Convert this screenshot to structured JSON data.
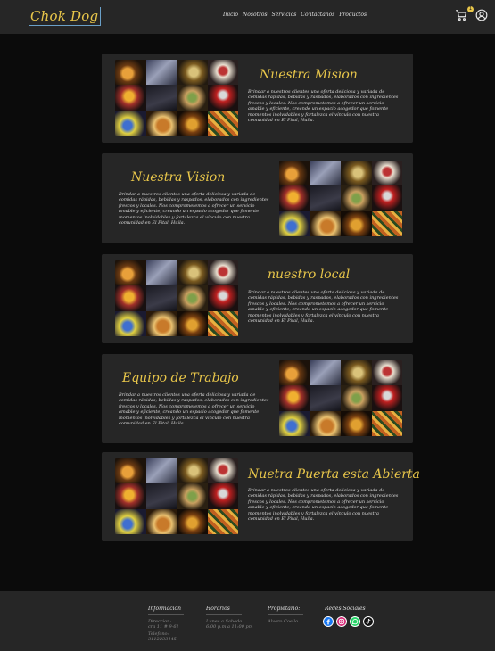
{
  "header": {
    "logo": "Chok Dog",
    "nav": [
      "Inicio",
      "Nosotros",
      "Servicios",
      "Contactanos",
      "Productos"
    ],
    "cart_count": "1"
  },
  "cards": [
    {
      "title": "Nuestra Mision",
      "text": "Brindar a nuestros clientes una oferta deliciosa y variada de comidas rápidas, bebidas y raspados, elaborados con ingredientes frescos y locales. Nos comprometemos a ofrecer un servicio amable y eficiente, creando un espacio acogedor que fomente momentos inolvidables y fortalezca el vínculo con nuestra comunidad en El Pital, Huila."
    },
    {
      "title": "Nuestra Vision",
      "text": "Brindar a nuestros clientes una oferta deliciosa y variada de comidas rápidas, bebidas y raspados, elaborados con ingredientes frescos y locales. Nos comprometemos a ofrecer un servicio amable y eficiente, creando un espacio acogedor que fomente momentos inolvidables y fortalezca el vínculo con nuestra comunidad en El Pital, Huila."
    },
    {
      "title": "nuestro local",
      "text": "Brindar a nuestros clientes una oferta deliciosa y variada de comidas rápidas, bebidas y raspados, elaborados con ingredientes frescos y locales. Nos comprometemos a ofrecer un servicio amable y eficiente, creando un espacio acogedor que fomente momentos inolvidables y fortalezca el vínculo con nuestra comunidad en El Pital, Huila."
    },
    {
      "title": "Equipo de Trabajo",
      "text": "Brindar a nuestros clientes una oferta deliciosa y variada de comidas rápidas, bebidas y raspados, elaborados con ingredientes frescos y locales. Nos comprometemos a ofrecer un servicio amable y eficiente, creando un espacio acogedor que fomente momentos inolvidables y fortalezca el vínculo con nuestra comunidad en El Pital, Huila."
    },
    {
      "title": "Nuetra Puerta esta Abierta",
      "text": "Brindar a nuestros clientes una oferta deliciosa y variada de comidas rápidas, bebidas y raspados, elaborados con ingredientes frescos y locales. Nos comprometemos a ofrecer un servicio amable y eficiente, creando un espacio acogedor que fomente momentos inolvidables y fortalezca el vínculo con nuestra comunidad en El Pital, Huila."
    }
  ],
  "footer": {
    "info": {
      "heading": "Informacion",
      "lines": [
        "Direccion:",
        "cra 11 # 9-61",
        "Telefono:",
        "3112233445"
      ]
    },
    "hours": {
      "heading": "Horarios",
      "lines": [
        "Lunes a Sabado",
        "6:00 p.m a 11:00 pm"
      ]
    },
    "owner": {
      "heading": "Propietario:",
      "lines": [
        "Alvaro Coello"
      ]
    },
    "social": {
      "heading": "Redes Sociales",
      "icons": [
        "facebook-icon",
        "instagram-icon",
        "whatsapp-icon",
        "tiktok-icon"
      ]
    }
  },
  "colors": {
    "accent": "#e8c64a",
    "panel": "#262626",
    "background": "#0b0b0b"
  }
}
